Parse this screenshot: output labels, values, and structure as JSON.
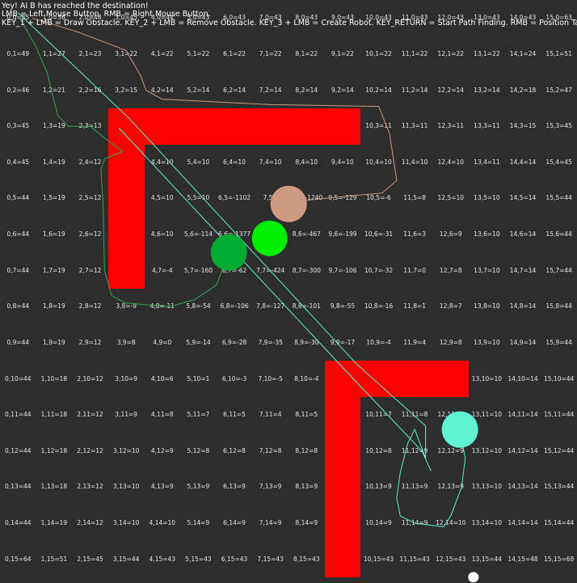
{
  "hud": {
    "status": "Yey! AI B has reached the destination!",
    "help_line_1": "LMB = Left Mouse Button. RMB = Right Mouse Button.",
    "help_line_2": "KEY_1 + LMB = Draw Obstacle. KEY_2 + LMB = Remove Obstacle. KEY_3 + LMB = Create Robot. KEY_RETURN = Start Path Finding. RMB = Position Target."
  },
  "grid": {
    "cols": 16,
    "rows": 16,
    "cells": [
      [
        "0,0=65",
        "1,0=56",
        "2,0=46",
        "3,0=45",
        "4,0=44",
        "5,0=43",
        "6,0=43",
        "7,0=43",
        "8,0=43",
        "9,0=43",
        "10,0=43",
        "11,0=43",
        "12,0=43",
        "13,0=43",
        "14,0=43",
        "15,0=63"
      ],
      [
        "0,1=49",
        "1,1=27",
        "2,1=23",
        "3,1=22",
        "4,1=22",
        "5,1=22",
        "6,1=22",
        "7,1=22",
        "8,1=22",
        "9,1=22",
        "10,1=22",
        "11,1=22",
        "12,1=22",
        "13,1=22",
        "14,1=24",
        "15,1=51"
      ],
      [
        "0,2=46",
        "1,2=21",
        "2,2=16",
        "3,2=15",
        "4,2=14",
        "5,2=14",
        "6,2=14",
        "7,2=14",
        "8,2=14",
        "9,2=14",
        "10,2=14",
        "11,2=14",
        "12,2=14",
        "13,2=14",
        "14,2=18",
        "15,2=47"
      ],
      [
        "0,3=45",
        "1,3=19",
        "2,3=13",
        "",
        "",
        "",
        "",
        "",
        "",
        "",
        "10,3=11",
        "11,3=11",
        "12,3=11",
        "13,3=11",
        "14,3=15",
        "15,3=45"
      ],
      [
        "0,4=45",
        "1,4=19",
        "2,4=12",
        "",
        "4,4=10",
        "5,4=10",
        "6,4=10",
        "7,4=10",
        "8,4=10",
        "9,4=10",
        "10,4=10",
        "11,4=10",
        "12,4=10",
        "13,4=11",
        "14,4=14",
        "15,4=45"
      ],
      [
        "0,5=44",
        "1,5=19",
        "2,5=12",
        "",
        "4,5=10",
        "5,5=10",
        "6,5=-1102",
        "7,5=",
        "8,5=-1240",
        "9,5=-129",
        "10,5=-6",
        "11,5=8",
        "12,5=10",
        "13,5=10",
        "14,5=14",
        "15,5=44"
      ],
      [
        "0,6=44",
        "1,6=19",
        "2,6=12",
        "",
        "4,6=10",
        "5,6=-114",
        "6,6=-1377",
        "7,6=-1098",
        "8,6=-467",
        "9,6=-199",
        "10,6=-31",
        "11,6=3",
        "12,6=9",
        "13,6=10",
        "14,6=14",
        "15,6=44"
      ],
      [
        "0,7=44",
        "1,7=19",
        "2,7=12",
        "",
        "4,7=-4",
        "5,7=-160",
        "6,7=-62",
        "7,7=-424",
        "8,7=-300",
        "9,7=-106",
        "10,7=-32",
        "11,7=0",
        "12,7=8",
        "13,7=10",
        "14,7=14",
        "15,7=44"
      ],
      [
        "0,8=44",
        "1,8=19",
        "2,8=12",
        "3,8=-9",
        "4,8=-11",
        "5,8=-54",
        "6,8=-106",
        "7,8=-127",
        "8,8=-101",
        "9,8=-55",
        "10,8=-16",
        "11,8=1",
        "12,8=7",
        "13,8=10",
        "14,8=14",
        "15,8=44"
      ],
      [
        "0,9=44",
        "1,9=19",
        "2,9=12",
        "3,9=8",
        "4,9=0",
        "5,9=-14",
        "6,9=-28",
        "7,9=-35",
        "8,9=-30",
        "9,9=-17",
        "10,9=-4",
        "11,9=4",
        "12,9=8",
        "13,9=10",
        "14,9=14",
        "15,9=44"
      ],
      [
        "0,10=44",
        "1,10=18",
        "2,10=12",
        "3,10=9",
        "4,10=6",
        "5,10=1",
        "6,10=-3",
        "7,10=-5",
        "8,10=-4",
        "",
        "",
        "",
        "",
        "13,10=10",
        "14,10=14",
        "15,10=44"
      ],
      [
        "0,11=44",
        "1,11=18",
        "2,11=12",
        "3,11=9",
        "4,11=8",
        "5,11=7",
        "6,11=5",
        "7,11=4",
        "8,11=5",
        "",
        "10,11=7",
        "11,11=8",
        "12,11=9",
        "13,11=10",
        "14,11=14",
        "15,11=44"
      ],
      [
        "0,12=44",
        "1,12=18",
        "2,12=12",
        "3,12=10",
        "4,12=9",
        "5,12=8",
        "6,12=8",
        "7,12=8",
        "8,12=8",
        "",
        "10,12=8",
        "11,12=9",
        "12,12=9",
        "13,12=10",
        "14,12=14",
        "15,12=44"
      ],
      [
        "0,13=44",
        "1,13=18",
        "2,13=12",
        "3,13=10",
        "4,13=9",
        "5,13=9",
        "6,13=9",
        "7,13=9",
        "8,13=9",
        "",
        "10,13=9",
        "11,13=9",
        "12,13=9",
        "13,13=10",
        "14,13=14",
        "15,13=44"
      ],
      [
        "0,14=44",
        "1,14=19",
        "2,14=12",
        "3,14=10",
        "4,14=10",
        "5,14=9",
        "6,14=9",
        "7,14=9",
        "8,14=9",
        "",
        "10,14=9",
        "11,14=9",
        "12,14=10",
        "13,14=10",
        "14,14=14",
        "15,14=44"
      ],
      [
        "0,15=64",
        "1,15=51",
        "2,15=45",
        "3,15=44",
        "4,15=43",
        "5,15=43",
        "6,15=43",
        "7,15=43",
        "8,15=43",
        "",
        "10,15=43",
        "11,15=43",
        "12,15=43",
        "13,15=44",
        "14,15=48",
        "15,15=68"
      ]
    ]
  },
  "obstacles": [
    {
      "col": 3,
      "row": 3,
      "w": 7,
      "h": 1
    },
    {
      "col": 3,
      "row": 4,
      "w": 1,
      "h": 4
    },
    {
      "col": 9,
      "row": 10,
      "w": 4,
      "h": 1
    },
    {
      "col": 9,
      "row": 11,
      "w": 1,
      "h": 5
    }
  ],
  "robots": [
    {
      "name": "robot-tan",
      "color": "#cf9a84",
      "col": 7.5,
      "row": 5.15,
      "r": 1.0
    },
    {
      "name": "robot-lime",
      "color": "#00ee00",
      "col": 6.98,
      "row": 6.1,
      "r": 1.0
    },
    {
      "name": "robot-green",
      "color": "#00aa33",
      "col": 5.85,
      "row": 6.5,
      "r": 1.0
    },
    {
      "name": "robot-aqua",
      "color": "#5ff3d2",
      "col": 12.25,
      "row": 11.4,
      "r": 1.0
    },
    {
      "name": "target-marker",
      "color": "#ffffff",
      "col": 12.63,
      "row": 15.5,
      "r": 0.3
    }
  ],
  "paths": [
    {
      "name": "path-tan",
      "color": "#cf9a84",
      "points": [
        [
          0.4,
          0.0
        ],
        [
          1.7,
          0.4
        ],
        [
          3.0,
          0.9
        ],
        [
          3.4,
          1.6
        ],
        [
          3.55,
          2.0
        ],
        [
          4.0,
          2.25
        ],
        [
          7.0,
          2.4
        ],
        [
          10.0,
          2.45
        ],
        [
          10.3,
          3.2
        ],
        [
          10.5,
          4.5
        ],
        [
          10.1,
          4.85
        ],
        [
          9.0,
          4.95
        ],
        [
          8.0,
          5.05
        ],
        [
          7.5,
          5.15
        ]
      ]
    },
    {
      "name": "path-green",
      "color": "#3aa655",
      "points": [
        [
          0.05,
          0.0
        ],
        [
          0.5,
          0.8
        ],
        [
          0.8,
          1.5
        ],
        [
          1.1,
          2.7
        ],
        [
          1.4,
          3.0
        ],
        [
          2.0,
          3.0
        ],
        [
          2.5,
          3.4
        ],
        [
          2.9,
          3.7
        ],
        [
          2.4,
          3.9
        ],
        [
          2.3,
          4.2
        ],
        [
          2.35,
          5.0
        ],
        [
          2.4,
          7.0
        ],
        [
          2.6,
          7.7
        ],
        [
          3.0,
          7.9
        ],
        [
          4.2,
          8.0
        ],
        [
          4.9,
          7.8
        ],
        [
          5.5,
          7.4
        ],
        [
          5.85,
          6.5
        ]
      ]
    },
    {
      "name": "path-aqua",
      "color": "#5ff3d2",
      "points": [
        [
          0.0,
          -0.15
        ],
        [
          3.1,
          2.8
        ],
        [
          9.4,
          9.6
        ],
        [
          11.3,
          11.3
        ],
        [
          11.3,
          12.2
        ],
        [
          11.0,
          11.4
        ],
        [
          10.8,
          11.8
        ],
        [
          10.6,
          12.6
        ],
        [
          10.5,
          13.3
        ],
        [
          10.6,
          13.8
        ],
        [
          11.0,
          14.0
        ],
        [
          11.8,
          14.1
        ],
        [
          12.0,
          13.8
        ],
        [
          12.3,
          13.0
        ],
        [
          12.4,
          12.2
        ],
        [
          12.25,
          11.4
        ]
      ]
    },
    {
      "name": "path-thin-teal",
      "color": "#5ff3d2",
      "points": [
        [
          2.8,
          3.05
        ],
        [
          9.3,
          10.0
        ],
        [
          11.2,
          12.0
        ],
        [
          11.45,
          12.55
        ]
      ]
    }
  ]
}
